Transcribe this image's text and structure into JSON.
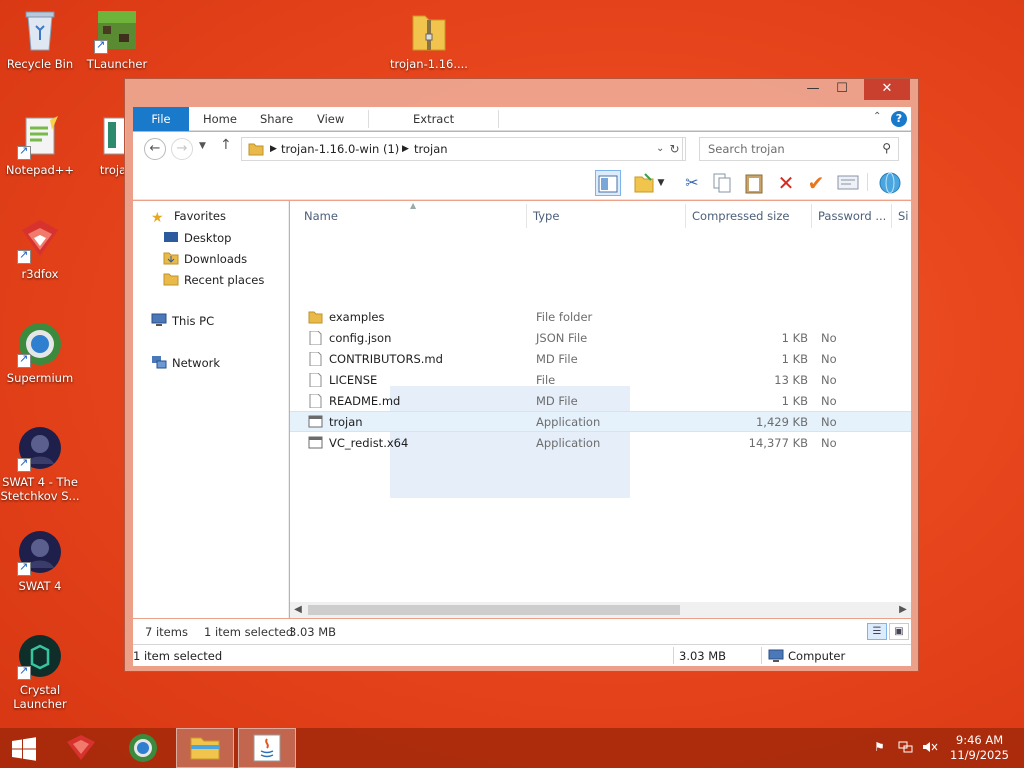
{
  "desktop": {
    "icons": [
      {
        "label": "Recycle Bin",
        "icon": "recycle-bin-icon"
      },
      {
        "label": "TLauncher",
        "icon": "tlauncher-icon"
      },
      {
        "label": "trojan-1.16....",
        "icon": "zip-folder-icon"
      },
      {
        "label": "Notepad++",
        "icon": "notepadpp-icon"
      },
      {
        "label": "troja",
        "icon": "trojan-shortcut-icon"
      },
      {
        "label": "r3dfox",
        "icon": "r3dfox-icon"
      },
      {
        "label": "Supermium",
        "icon": "supermium-icon"
      },
      {
        "label": "SWAT 4 - The Stetchkov S...",
        "icon": "swat4-expansion-icon"
      },
      {
        "label": "SWAT 4",
        "icon": "swat4-icon"
      },
      {
        "label": "Crystal Launcher",
        "icon": "crystal-launcher-icon"
      }
    ]
  },
  "window": {
    "controls": {
      "minimize": "—",
      "maximize": "☐",
      "close": "✕"
    },
    "ribbon_tabs": [
      "File",
      "Home",
      "Share",
      "View",
      "Extract"
    ],
    "address": {
      "crumbs": [
        "trojan-1.16.0-win (1)",
        "trojan"
      ]
    },
    "search": {
      "placeholder": "Search trojan"
    },
    "nav_pane": {
      "favorites": "Favorites",
      "favorite_items": [
        "Desktop",
        "Downloads",
        "Recent places"
      ],
      "this_pc": "This PC",
      "network": "Network"
    },
    "columns": [
      "Name",
      "Type",
      "Compressed size",
      "Password ...",
      "Si"
    ],
    "files": [
      {
        "name": "examples",
        "type": "File folder",
        "size": "",
        "password": "",
        "icon": "folder-icon"
      },
      {
        "name": "config.json",
        "type": "JSON File",
        "size": "1 KB",
        "password": "No",
        "icon": "file-icon"
      },
      {
        "name": "CONTRIBUTORS.md",
        "type": "MD File",
        "size": "1 KB",
        "password": "No",
        "icon": "file-icon"
      },
      {
        "name": "LICENSE",
        "type": "File",
        "size": "13 KB",
        "password": "No",
        "icon": "file-icon"
      },
      {
        "name": "README.md",
        "type": "MD File",
        "size": "1 KB",
        "password": "No",
        "icon": "file-icon"
      },
      {
        "name": "trojan",
        "type": "Application",
        "size": "1,429 KB",
        "password": "No",
        "icon": "application-icon",
        "selected": true
      },
      {
        "name": "VC_redist.x64",
        "type": "Application",
        "size": "14,377 KB",
        "password": "No",
        "icon": "application-icon"
      }
    ],
    "status": {
      "item_count": "7 items",
      "selected": "1 item selected",
      "selected_size": "3.03 MB",
      "bottom_selected": "1 item selected",
      "bottom_size": "3.03 MB",
      "location": "Computer"
    }
  },
  "taskbar": {
    "time": "9:46 AM",
    "date": "11/9/2025"
  }
}
